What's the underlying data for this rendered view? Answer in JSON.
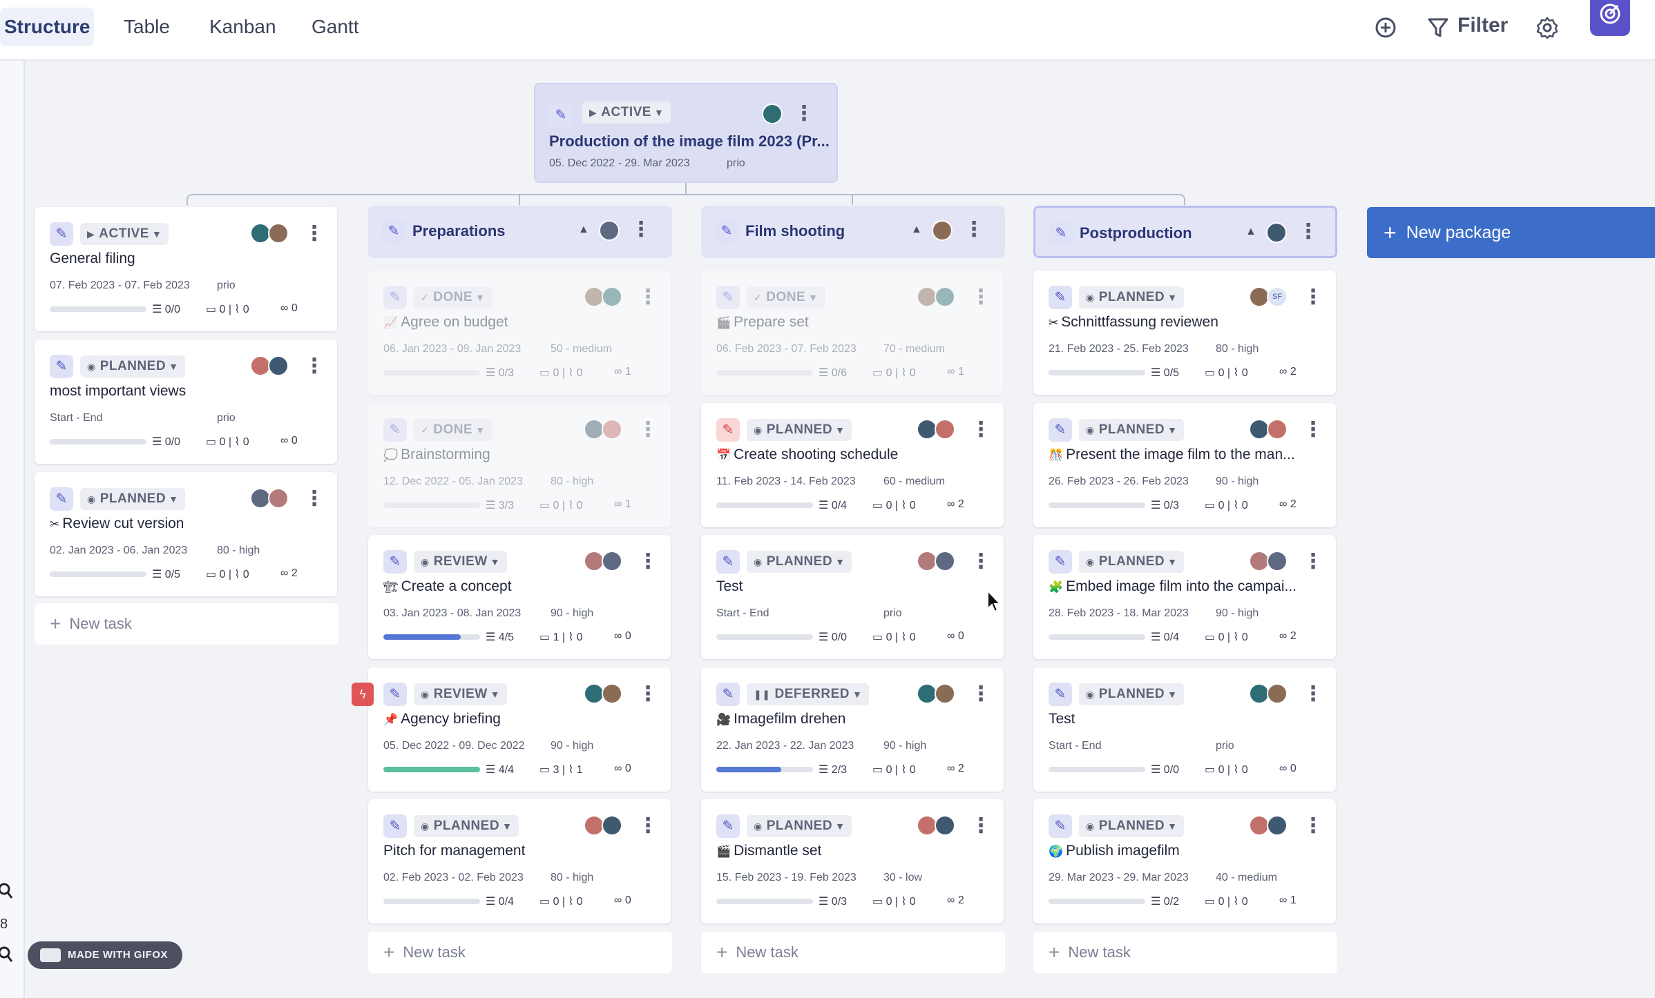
{
  "tabs": [
    {
      "label": "Structure",
      "active": true
    },
    {
      "label": "Table"
    },
    {
      "label": "Kanban"
    },
    {
      "label": "Gantt"
    }
  ],
  "toolbar": {
    "filter_label": "Filter",
    "add_icon": "add-circle-icon",
    "filter_icon": "filter-icon",
    "settings_icon": "gear-icon"
  },
  "rail_text": "8",
  "root": {
    "status": "ACTIVE",
    "title": "Production of the image film 2023 (Pr...",
    "dates": "05. Dec 2022 - 29. Mar 2023",
    "prio": "prio"
  },
  "new_package_label": "New package",
  "new_task_label": "New task",
  "gifox_label": "MADE WITH GIFOX",
  "colors": {
    "accent": "#3c6ec9",
    "progress_blue": "#5578d6",
    "progress_green": "#5bbf9f",
    "package_bg": "#e3e5f6"
  },
  "standalone": [
    {
      "status": "ACTIVE",
      "title": "General filing",
      "dates": "07. Feb 2023 - 07. Feb 2023",
      "prio": "prio",
      "progress": 0,
      "checklist": "0/0",
      "comments": "0",
      "attachments": "0",
      "links": "0"
    },
    {
      "status": "PLANNED",
      "title": "most important views",
      "dates": "Start - End",
      "prio": "prio",
      "progress": 0,
      "checklist": "0/0",
      "comments": "0",
      "attachments": "0",
      "links": "0"
    },
    {
      "status": "PLANNED",
      "emoji": "✂",
      "title": "Review cut version",
      "dates": "02. Jan 2023 - 06. Jan 2023",
      "prio": "80 - high",
      "progress": 0,
      "checklist": "0/5",
      "comments": "0",
      "attachments": "0",
      "links": "2"
    }
  ],
  "packages": [
    {
      "title": "Preparations",
      "tasks": [
        {
          "status": "DONE",
          "emoji": "📈",
          "title": "Agree on budget",
          "dates": "06. Jan 2023 - 09. Jan 2023",
          "prio": "50 - medium",
          "progress": 0,
          "checklist": "0/3",
          "comments": "0",
          "attachments": "0",
          "links": "1",
          "faded": true
        },
        {
          "status": "DONE",
          "emoji": "💭",
          "title": "Brainstorming",
          "dates": "12. Dec 2022 - 05. Jan 2023",
          "prio": "80 - high",
          "progress": 0,
          "checklist": "3/3",
          "comments": "0",
          "attachments": "0",
          "links": "1",
          "faded": true
        },
        {
          "status": "REVIEW",
          "emoji": "🏗",
          "title": "Create a concept",
          "dates": "03. Jan 2023 - 08. Jan 2023",
          "prio": "90 - high",
          "progress": 0.8,
          "checklist": "4/5",
          "comments": "1",
          "attachments": "0",
          "links": "0"
        },
        {
          "status": "REVIEW",
          "emoji": "📌",
          "title": "Agency briefing",
          "dates": "05. Dec 2022 - 09. Dec 2022",
          "prio": "90 - high",
          "progress": 1.0,
          "checklist": "4/4",
          "comments": "3",
          "attachments": "1",
          "links": "0",
          "flag": true
        },
        {
          "status": "PLANNED",
          "title": "Pitch for management",
          "dates": "02. Feb 2023 - 02. Feb 2023",
          "prio": "80 - high",
          "progress": 0,
          "checklist": "0/4",
          "comments": "0",
          "attachments": "0",
          "links": "0"
        }
      ]
    },
    {
      "title": "Film shooting",
      "tasks": [
        {
          "status": "DONE",
          "emoji": "🎬",
          "title": "Prepare set",
          "dates": "06. Feb 2023 - 07. Feb 2023",
          "prio": "70 - medium",
          "progress": 0,
          "checklist": "0/6",
          "comments": "0",
          "attachments": "0",
          "links": "1",
          "faded": true
        },
        {
          "status": "PLANNED",
          "emoji": "📅",
          "title": "Create shooting schedule",
          "dates": "11. Feb 2023 - 14. Feb 2023",
          "prio": "60 - medium",
          "progress": 0,
          "checklist": "0/4",
          "comments": "0",
          "attachments": "0",
          "links": "2",
          "pen": "red"
        },
        {
          "status": "PLANNED",
          "title": "Test",
          "dates": "Start - End",
          "prio": "prio",
          "progress": 0,
          "checklist": "0/0",
          "comments": "0",
          "attachments": "0",
          "links": "0"
        },
        {
          "status": "DEFERRED",
          "emoji": "🎥",
          "title": "Imagefilm drehen",
          "dates": "22. Jan 2023 - 22. Jan 2023",
          "prio": "90 - high",
          "progress": 0.67,
          "checklist": "2/3",
          "comments": "0",
          "attachments": "0",
          "links": "2"
        },
        {
          "status": "PLANNED",
          "emoji": "🎬",
          "title": "Dismantle set",
          "dates": "15. Feb 2023 - 19. Feb 2023",
          "prio": "30 - low",
          "progress": 0,
          "checklist": "0/3",
          "comments": "0",
          "attachments": "0",
          "links": "2"
        }
      ]
    },
    {
      "title": "Postproduction",
      "selected": true,
      "tasks": [
        {
          "status": "PLANNED",
          "emoji": "✂",
          "title": "Schnittfassung reviewen",
          "dates": "21. Feb 2023 - 25. Feb 2023",
          "prio": "80 - high",
          "progress": 0,
          "checklist": "0/5",
          "comments": "0",
          "attachments": "0",
          "links": "2",
          "avatar_text": "SF"
        },
        {
          "status": "PLANNED",
          "emoji": "🎊",
          "title": "Present the image film to the man...",
          "dates": "26. Feb 2023 - 26. Feb 2023",
          "prio": "90 - high",
          "progress": 0,
          "checklist": "0/3",
          "comments": "0",
          "attachments": "0",
          "links": "2"
        },
        {
          "status": "PLANNED",
          "emoji": "🧩",
          "title": "Embed image film into the campai...",
          "dates": "28. Feb 2023 - 18. Mar 2023",
          "prio": "90 - high",
          "progress": 0,
          "checklist": "0/4",
          "comments": "0",
          "attachments": "0",
          "links": "2"
        },
        {
          "status": "PLANNED",
          "title": "Test",
          "dates": "Start - End",
          "prio": "prio",
          "progress": 0,
          "checklist": "0/0",
          "comments": "0",
          "attachments": "0",
          "links": "0"
        },
        {
          "status": "PLANNED",
          "emoji": "🌍",
          "title": "Publish imagefilm",
          "dates": "29. Mar 2023 - 29. Mar 2023",
          "prio": "40 - medium",
          "progress": 0,
          "checklist": "0/2",
          "comments": "0",
          "attachments": "0",
          "links": "1"
        }
      ]
    }
  ]
}
